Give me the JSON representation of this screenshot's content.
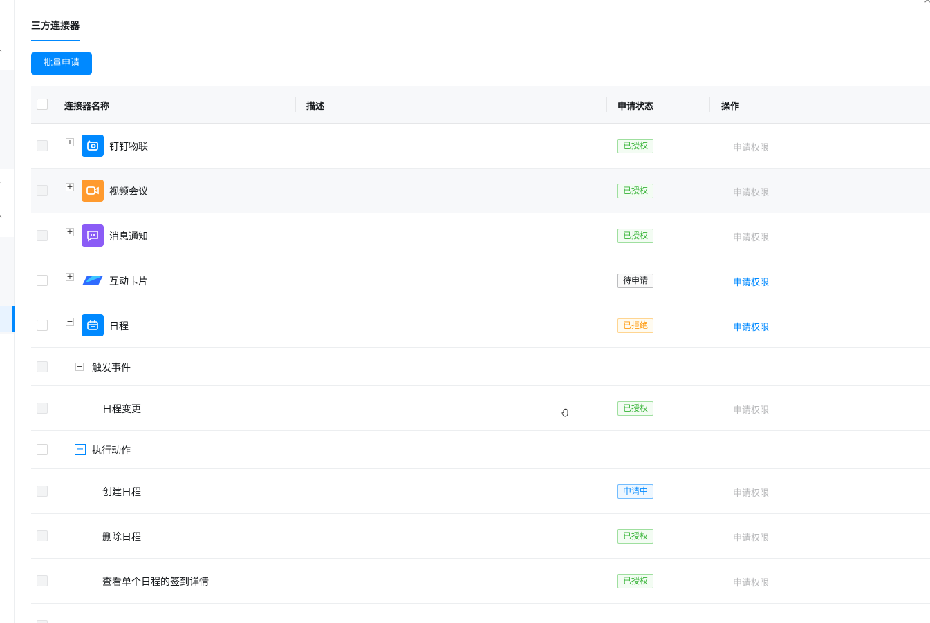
{
  "close_glyph": "×",
  "tabs": [
    {
      "label": "三方连接器",
      "active": true
    }
  ],
  "batch_button": "批量申请",
  "table": {
    "columns": [
      "连接器名称",
      "描述",
      "申请状态",
      "操作"
    ],
    "rows": [
      {
        "type": "app",
        "expander": "+",
        "icon": "camera-icon",
        "icon_color": "#0089ff",
        "name": "钉钉物联",
        "status": "已授权",
        "status_type": "green",
        "action": "申请权限",
        "action_enabled": false
      },
      {
        "type": "app",
        "expander": "+",
        "icon": "video-icon",
        "icon_color": "#ff9a2e",
        "name": "视频会议",
        "status": "已授权",
        "status_type": "green",
        "action": "申请权限",
        "action_enabled": false
      },
      {
        "type": "app",
        "expander": "+",
        "icon": "message-icon",
        "icon_color": "#8b5cf6",
        "name": "消息通知",
        "status": "已授权",
        "status_type": "green",
        "action": "申请权限",
        "action_enabled": false
      },
      {
        "type": "app",
        "expander": "+",
        "icon": "card-icon",
        "icon_color": "#2f6bff",
        "name": "互动卡片",
        "status": "待申请",
        "status_type": "gray",
        "action": "申请权限",
        "action_enabled": true
      },
      {
        "type": "app",
        "expander": "−",
        "icon": "calendar-icon",
        "icon_color": "#0089ff",
        "name": "日程",
        "status": "已拒绝",
        "status_type": "orange",
        "action": "申请权限",
        "action_enabled": true
      },
      {
        "type": "group",
        "expander": "−",
        "name": "触发事件"
      },
      {
        "type": "item",
        "name": "日程变更",
        "status": "已授权",
        "status_type": "green",
        "action": "申请权限",
        "action_enabled": false
      },
      {
        "type": "group",
        "expander": "−",
        "name": "执行动作"
      },
      {
        "type": "item",
        "name": "创建日程",
        "status": "申请中",
        "status_type": "blue",
        "action": "申请权限",
        "action_enabled": false
      },
      {
        "type": "item",
        "name": "删除日程",
        "status": "已授权",
        "status_type": "green",
        "action": "申请权限",
        "action_enabled": false
      },
      {
        "type": "item",
        "name": "查看单个日程的签到详情",
        "status": "已授权",
        "status_type": "green",
        "action": "申请权限",
        "action_enabled": false
      }
    ]
  }
}
